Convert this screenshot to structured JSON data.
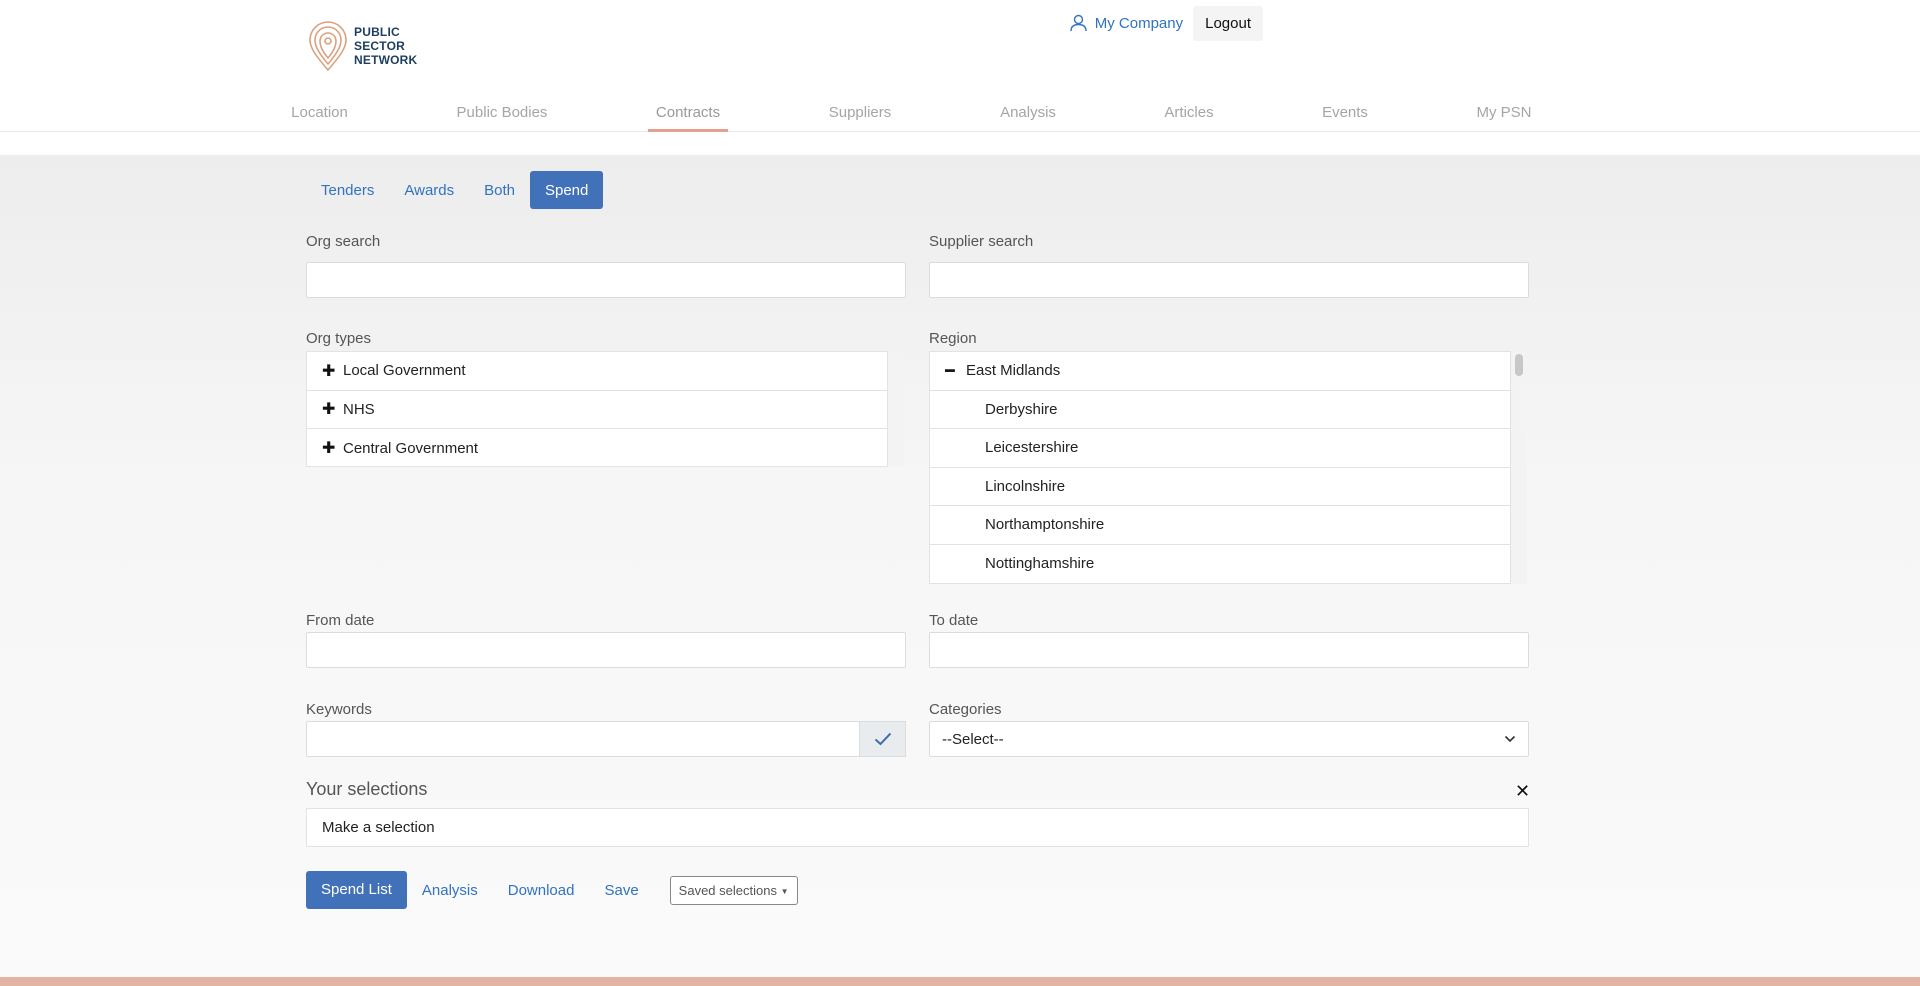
{
  "header": {
    "logo_lines": [
      "PUBLIC",
      "SECTOR",
      "NETWORK"
    ],
    "my_company": "My Company",
    "logout": "Logout"
  },
  "nav": {
    "items": [
      "Location",
      "Public Bodies",
      "Contracts",
      "Suppliers",
      "Analysis",
      "Articles",
      "Events",
      "My PSN"
    ],
    "active": "Contracts"
  },
  "tabs": {
    "items": [
      "Tenders",
      "Awards",
      "Both",
      "Spend"
    ],
    "active": "Spend"
  },
  "form": {
    "org_search_label": "Org search",
    "org_search_value": "",
    "supplier_search_label": "Supplier search",
    "supplier_search_value": "",
    "org_types_label": "Org types",
    "org_types": [
      {
        "label": "Local Government",
        "icon": "plus-icon"
      },
      {
        "label": "NHS",
        "icon": "plus-icon"
      },
      {
        "label": "Central Government",
        "icon": "plus-icon"
      }
    ],
    "region_label": "Region",
    "region_group": {
      "label": "East Midlands",
      "icon": "minus-icon"
    },
    "region_items": [
      "Derbyshire",
      "Leicestershire",
      "Lincolnshire",
      "Northamptonshire",
      "Nottinghamshire"
    ],
    "from_date_label": "From date",
    "from_date_value": "",
    "to_date_label": "To date",
    "to_date_value": "",
    "keywords_label": "Keywords",
    "keywords_value": "",
    "categories_label": "Categories",
    "categories_selected": "--Select--"
  },
  "selections": {
    "title": "Your selections",
    "placeholder": "Make a selection"
  },
  "actions": {
    "spend_list": "Spend List",
    "analysis": "Analysis",
    "download": "Download",
    "save": "Save",
    "saved_selections": "Saved selections"
  },
  "colors": {
    "primary": "#4171b8",
    "link": "#3173c0",
    "accent": "#e4a08f"
  }
}
